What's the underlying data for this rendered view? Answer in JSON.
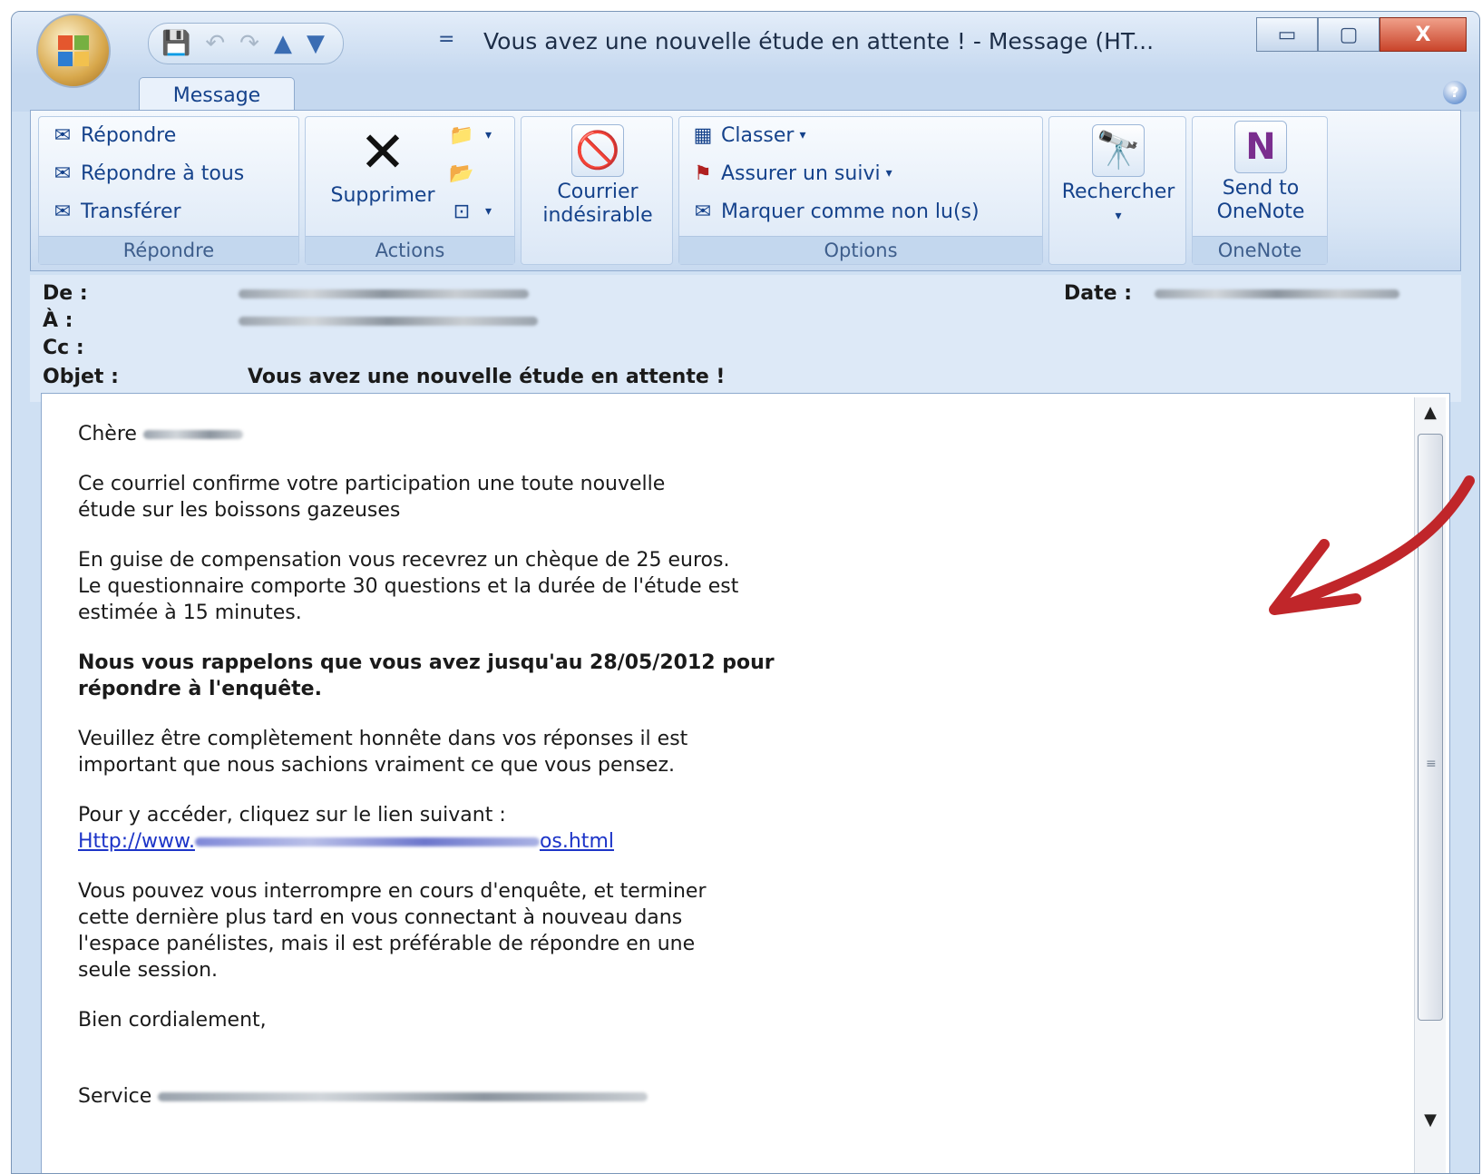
{
  "window": {
    "title": "Vous avez une nouvelle étude en attente ! - Message (HT...",
    "minimize_glyph": "▭",
    "maximize_glyph": "▢",
    "close_glyph": "X"
  },
  "quick_access": {
    "save_icon": "💾",
    "undo_icon": "↶",
    "redo_icon": "↷",
    "up_icon": "▲",
    "down_icon": "▼",
    "customize_glyph": "="
  },
  "tabs": [
    {
      "label": "Message"
    }
  ],
  "help_glyph": "?",
  "ribbon": {
    "groups": {
      "repondre": {
        "label": "Répondre",
        "items": [
          {
            "label": "Répondre",
            "icon": "reply-icon"
          },
          {
            "label": "Répondre à tous",
            "icon": "reply-all-icon"
          },
          {
            "label": "Transférer",
            "icon": "forward-icon"
          }
        ]
      },
      "actions": {
        "label": "Actions",
        "delete_label": "Supprimer",
        "delete_glyph": "✕"
      },
      "junk": {
        "label_line1": "Courrier",
        "label_line2": "indésirable"
      },
      "options": {
        "label": "Options",
        "classer": "Classer",
        "suivi": "Assurer un suivi",
        "nonlu": "Marquer comme non lu(s)"
      },
      "search": {
        "label": "Rechercher",
        "glyph": "🔭"
      },
      "onenote": {
        "label": "OneNote",
        "btn_line1": "Send to",
        "btn_line2": "OneNote",
        "glyph": "N"
      }
    }
  },
  "header": {
    "from_label": "De :",
    "to_label": "À :",
    "cc_label": "Cc :",
    "subject_label": "Objet :",
    "subject": "Vous avez une nouvelle étude en attente !",
    "date_label": "Date :"
  },
  "body": {
    "greeting": "Chère",
    "p1_l1": "Ce courriel confirme votre participation une toute nouvelle",
    "p1_l2": "étude sur les boissons gazeuses",
    "p2_l1": "En guise de compensation vous recevrez un chèque de 25 euros.",
    "p2_l2": "Le questionnaire comporte 30 questions et la durée de l'étude est",
    "p2_l3": "estimée à 15 minutes.",
    "p3_l1": "Nous vous rappelons que vous avez jusqu'au 28/05/2012 pour",
    "p3_l2": "répondre à l'enquête.",
    "p4_l1": "Veuillez être complètement honnête dans vos réponses il est",
    "p4_l2": "important que nous sachions vraiment ce que vous pensez.",
    "p5_l1": "Pour y accéder, cliquez sur le lien suivant :",
    "link_prefix": "Http://www.",
    "link_suffix": "os.html",
    "p6_l1": "Vous pouvez vous interrompre en cours d'enquête, et terminer",
    "p6_l2": "cette dernière plus tard en vous connectant à nouveau dans",
    "p6_l3": "l'espace panélistes, mais il est préférable de répondre en une",
    "p6_l4": "seule session.",
    "closing": "Bien cordialement,",
    "signature": "Service"
  },
  "colors": {
    "accent": "#15428b",
    "link": "#1c34c8",
    "annotation_arrow": "#c0262a"
  }
}
